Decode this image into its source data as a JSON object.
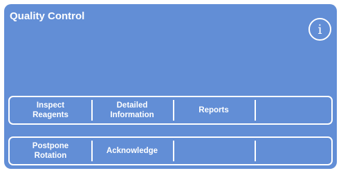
{
  "header": {
    "title": "Quality Control",
    "info_icon": "info-icon",
    "info_glyph": "i"
  },
  "row1": {
    "buttons": [
      {
        "label": "Inspect\nReagents"
      },
      {
        "label": "Detailed\nInformation"
      },
      {
        "label": "Reports"
      },
      {
        "label": ""
      }
    ]
  },
  "row2": {
    "buttons": [
      {
        "label": "Postpone\nRotation"
      },
      {
        "label": "Acknowledge"
      },
      {
        "label": ""
      },
      {
        "label": ""
      }
    ]
  },
  "colors": {
    "panel_background": "#628ed6",
    "text": "#ffffff",
    "border": "#ffffff"
  }
}
